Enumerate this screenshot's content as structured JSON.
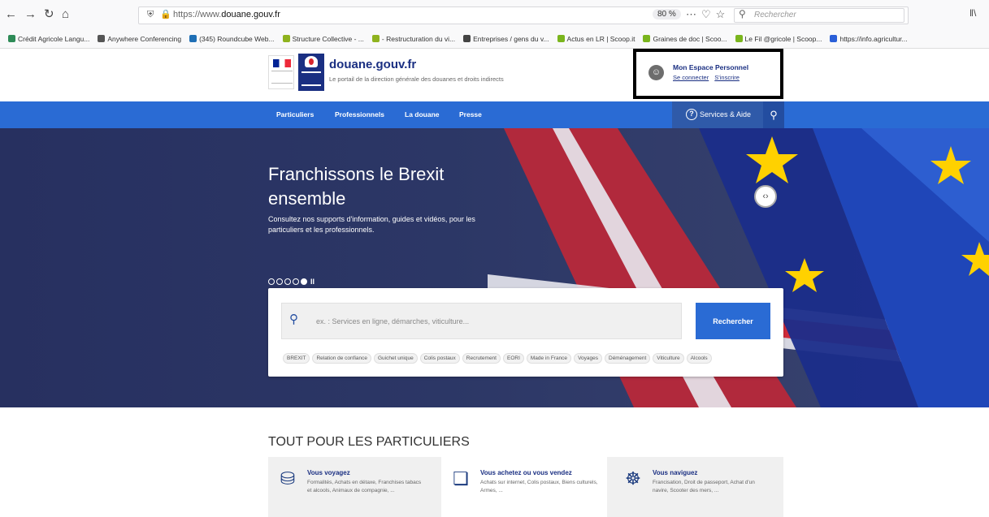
{
  "browser": {
    "url_prefix": "https://www.",
    "url_domain": "douane.gouv.fr",
    "zoom": "80 %",
    "search_placeholder": "Rechercher",
    "bookmarks": [
      {
        "label": "Crédit Agricole Langu...",
        "color": "#2e8b57"
      },
      {
        "label": "Anywhere Conferencing",
        "color": "#555555"
      },
      {
        "label": "(345) Roundcube Web...",
        "color": "#1f6fb5"
      },
      {
        "label": "Structure Collective - ...",
        "color": "#8fb31f"
      },
      {
        "label": "- Restructuration du vi...",
        "color": "#8fb31f"
      },
      {
        "label": "Entreprises / gens du v...",
        "color": "#444444"
      },
      {
        "label": "Actus en LR | Scoop.it",
        "color": "#7ab51d"
      },
      {
        "label": "Graines de doc | Scoo...",
        "color": "#7ab51d"
      },
      {
        "label": "Le Fil @gricole | Scoop...",
        "color": "#7ab51d"
      },
      {
        "label": "https://info.agricultur...",
        "color": "#2a5fd8"
      }
    ]
  },
  "header": {
    "site_title": "douane.gouv.fr",
    "site_subtitle": "Le portail de la direction générale des douanes et droits indirects",
    "espace_title": "Mon Espace Personnel",
    "login_link": "Se connecter",
    "signup_link": "S'inscrire"
  },
  "nav": {
    "items": [
      "Particuliers",
      "Professionnels",
      "La douane",
      "Presse"
    ],
    "services_label": "Services & Aide"
  },
  "hero": {
    "title_line1": "Franchissons le Brexit",
    "title_line2": "ensemble",
    "description": "Consultez nos supports d'information, guides et vidéos, pour les particuliers et les professionnels.",
    "slide_count": 5,
    "active_slide": 5
  },
  "search": {
    "placeholder": "ex. : Services en ligne, démarches, viticulture...",
    "button_label": "Rechercher",
    "tags": [
      "BREXIT",
      "Relation de confiance",
      "Guichet unique",
      "Colis postaux",
      "Recrutement",
      "EORI",
      "Made in France",
      "Voyages",
      "Déménagement",
      "Viticulture",
      "Alcools"
    ]
  },
  "section": {
    "title": "TOUT POUR LES PARTICULIERS",
    "cards": [
      {
        "title": "Vous voyagez",
        "description": "Formalités, Achats en détaxe, Franchises tabacs et alcools, Animaux de compagnie, ..."
      },
      {
        "title": "Vous achetez ou vous vendez",
        "description": "Achats sur internet, Colis postaux, Biens culturels, Armes, ..."
      },
      {
        "title": "Vous naviguez",
        "description": "Francisation, Droit de passeport, Achat d'un navire, Scooter des mers, ..."
      }
    ]
  },
  "colors": {
    "nav_blue": "#2a6bd4",
    "brand_navy": "#1a2f82",
    "hero_bg": "#2b3561"
  }
}
